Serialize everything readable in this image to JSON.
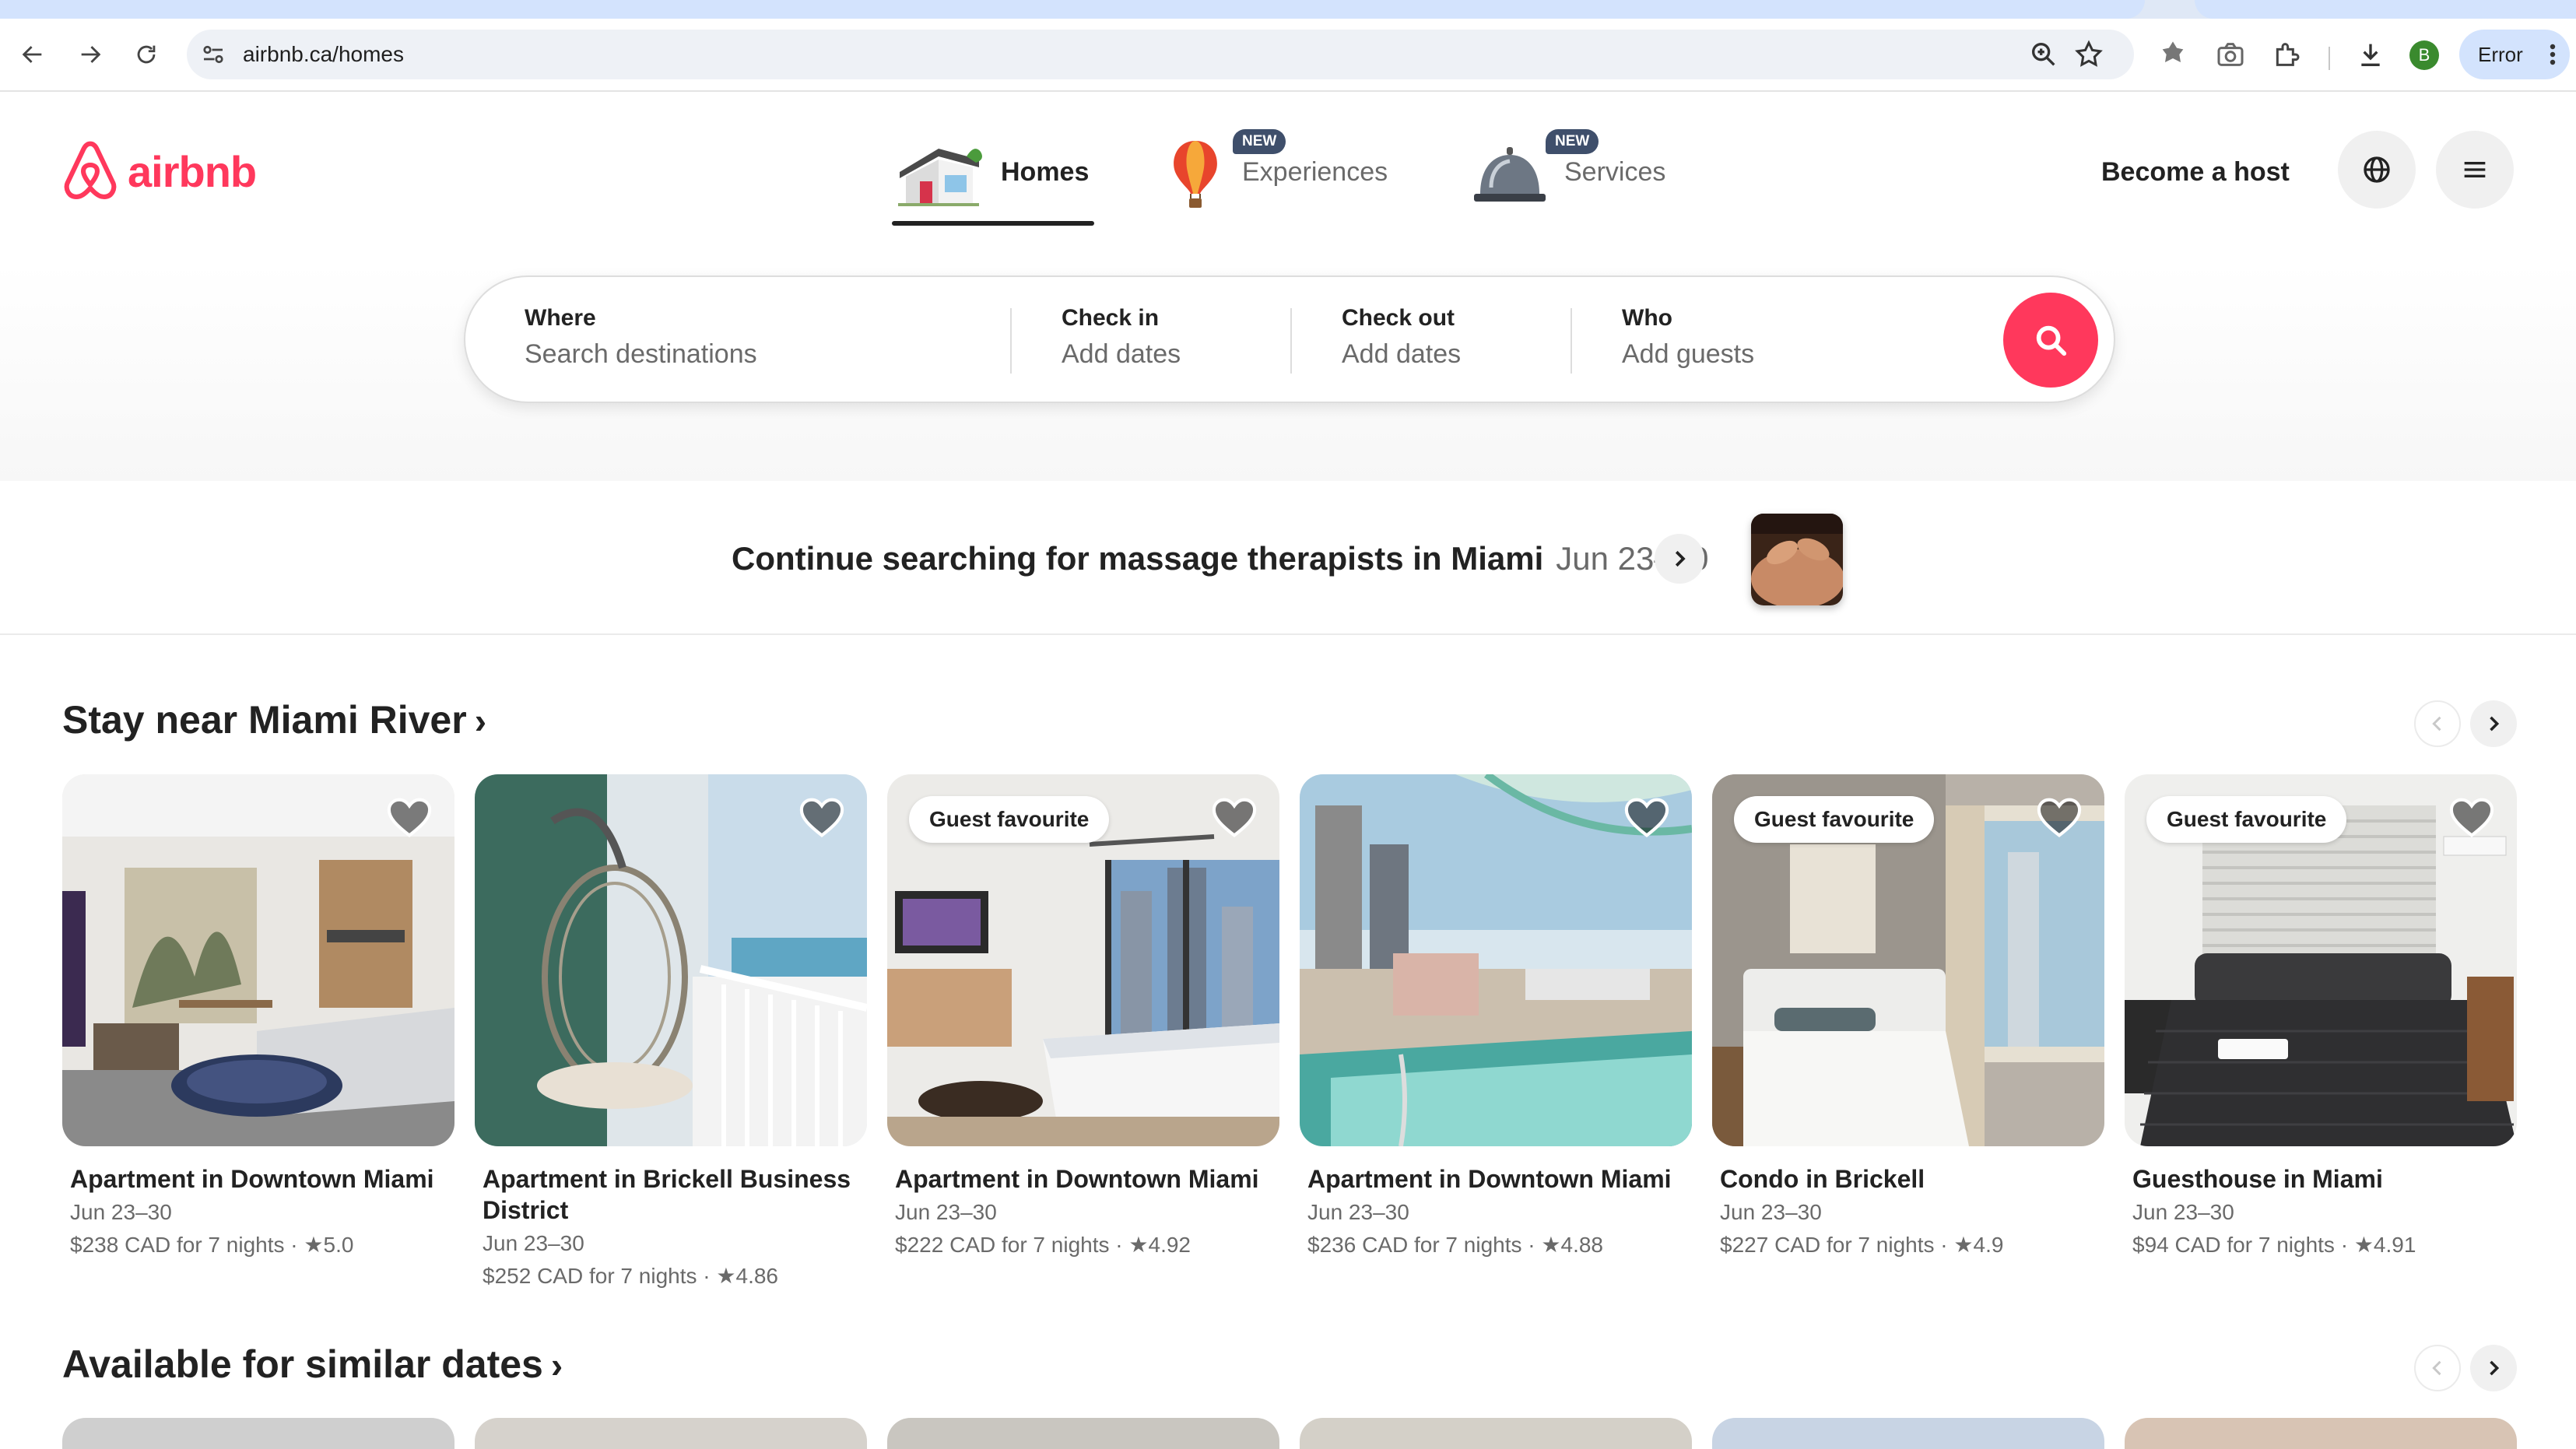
{
  "browser": {
    "url": "airbnb.ca/homes",
    "profile_initial": "B",
    "error_label": "Error"
  },
  "brand": {
    "name": "airbnb",
    "color": "#ff385c"
  },
  "categories": [
    {
      "label": "Homes",
      "badge": "",
      "active": true
    },
    {
      "label": "Experiences",
      "badge": "NEW",
      "active": false
    },
    {
      "label": "Services",
      "badge": "NEW",
      "active": false
    }
  ],
  "header": {
    "become_host": "Become a host"
  },
  "search": {
    "where_label": "Where",
    "where_placeholder": "Search destinations",
    "checkin_label": "Check in",
    "checkin_placeholder": "Add dates",
    "checkout_label": "Check out",
    "checkout_placeholder": "Add dates",
    "who_label": "Who",
    "who_placeholder": "Add guests"
  },
  "continue_search": {
    "text": "Continue searching for massage therapists in Miami",
    "dates": "Jun 23–30"
  },
  "section1": {
    "title": "Stay near Miami River",
    "listings": [
      {
        "title": "Apartment in Downtown Miami",
        "dates": "Jun 23–30",
        "price": "$238 CAD for 7 nights",
        "rating": "5.0",
        "badge": ""
      },
      {
        "title": "Apartment in Brickell Business District",
        "dates": "Jun 23–30",
        "price": "$252 CAD for 7 nights",
        "rating": "4.86",
        "badge": ""
      },
      {
        "title": "Apartment in Downtown Miami",
        "dates": "Jun 23–30",
        "price": "$222 CAD for 7 nights",
        "rating": "4.92",
        "badge": "Guest favourite"
      },
      {
        "title": "Apartment in Downtown Miami",
        "dates": "Jun 23–30",
        "price": "$236 CAD for 7 nights",
        "rating": "4.88",
        "badge": ""
      },
      {
        "title": "Condo in Brickell",
        "dates": "Jun 23–30",
        "price": "$227 CAD for 7 nights",
        "rating": "4.9",
        "badge": "Guest favourite"
      },
      {
        "title": "Guesthouse in Miami",
        "dates": "Jun 23–30",
        "price": "$94 CAD for 7 nights",
        "rating": "4.91",
        "badge": "Guest favourite"
      }
    ]
  },
  "section2": {
    "title": "Available for similar dates"
  },
  "icons": {
    "back": "back-arrow-icon",
    "forward": "forward-arrow-icon",
    "reload": "reload-icon",
    "site_info": "site-info-icon",
    "zoom": "zoom-icon",
    "bookmark": "star-icon",
    "globe": "globe-icon",
    "menu": "hamburger-icon",
    "search": "search-icon",
    "heart": "heart-icon",
    "chevron": "chevron-right-icon"
  }
}
